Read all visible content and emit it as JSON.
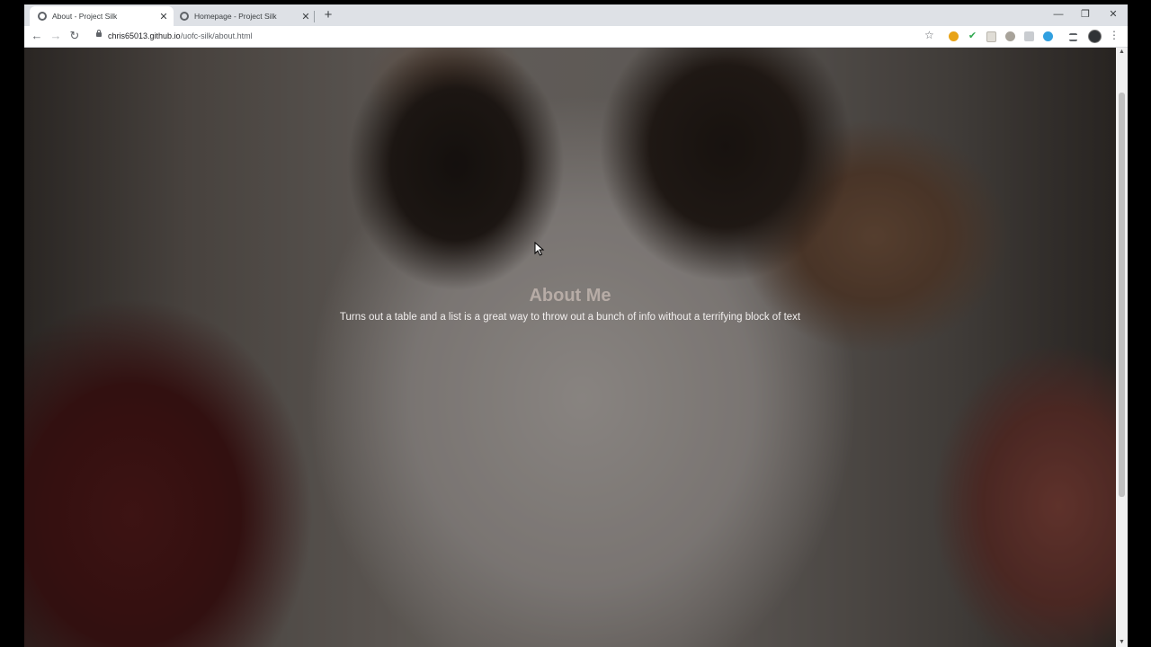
{
  "browser": {
    "tabs": [
      {
        "title": "About - Project Silk",
        "active": true
      },
      {
        "title": "Homepage - Project Silk",
        "active": false
      }
    ],
    "new_tab_symbol": "+",
    "close_symbol": "✕",
    "window_controls": {
      "minimize": "—",
      "restore": "❐",
      "close": "✕"
    },
    "nav": {
      "back": "←",
      "forward": "→",
      "reload": "↻"
    },
    "url_host": "chris65013.github.io",
    "url_path": "/uofc-silk/about.html",
    "bookmark_symbol": "☆",
    "menu_symbol": "⋮",
    "extensions": [
      "orange-circle-extension",
      "green-check-extension",
      "page-extension",
      "coin-extension",
      "puzzle-extension",
      "skype-extension",
      "playlist-extension",
      "profile-avatar"
    ]
  },
  "page": {
    "heading": "About Me",
    "subheading": "Turns out a table and a list is a great way to throw out a bunch of info without a terrifying block of text"
  },
  "colors": {
    "heading": "#b7aca6",
    "subheading": "#f2efee",
    "tabstrip": "#dee1e6"
  }
}
